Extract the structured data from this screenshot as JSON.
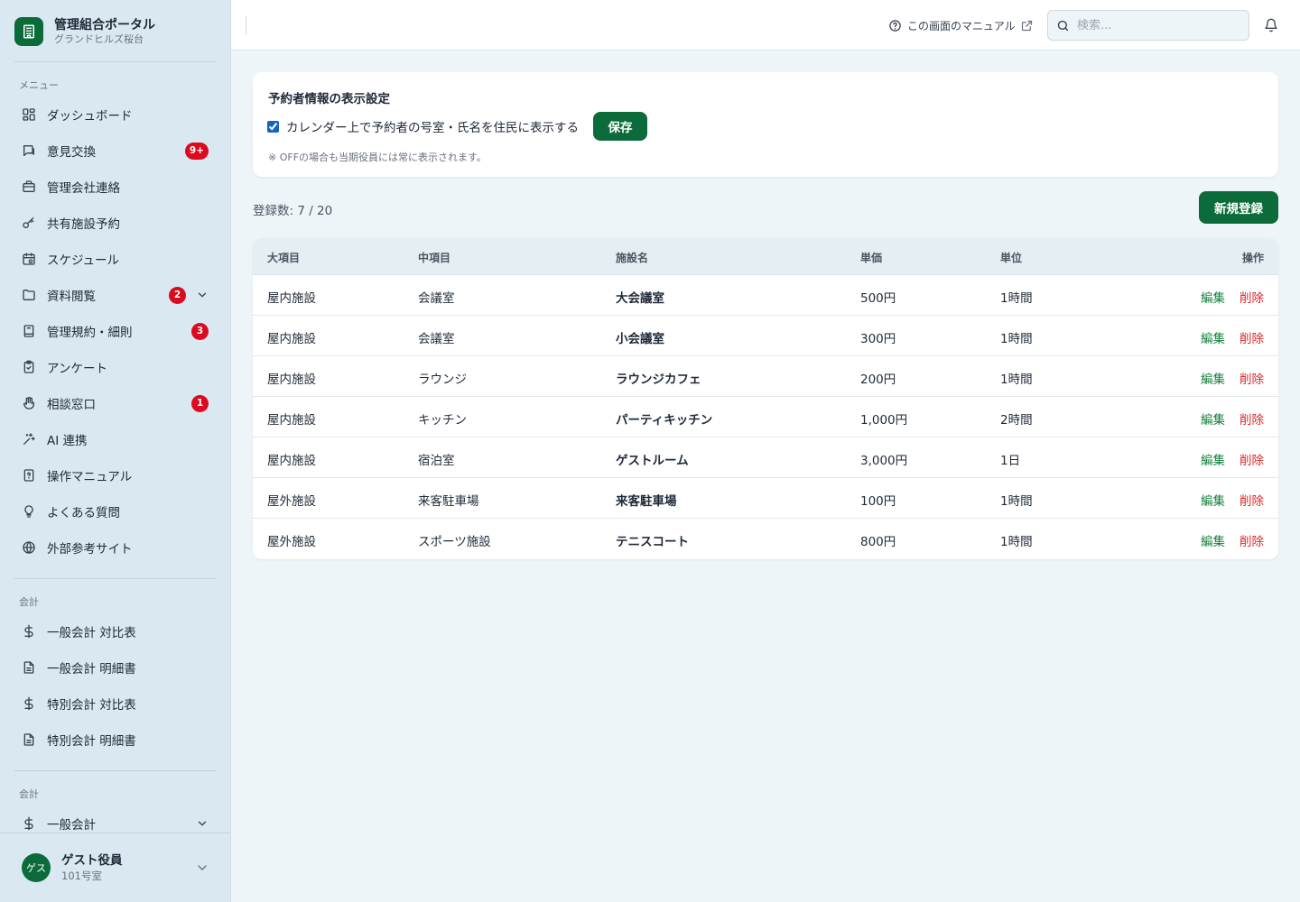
{
  "brand": {
    "title": "管理組合ポータル",
    "subtitle": "グランドヒルズ桜台"
  },
  "sidebar": {
    "menu_label": "メニュー",
    "items": [
      {
        "label": "ダッシュボード",
        "icon": "dashboard-icon"
      },
      {
        "label": "意見交換",
        "icon": "chat-icon",
        "badge": "9+"
      },
      {
        "label": "管理会社連絡",
        "icon": "briefcase-icon"
      },
      {
        "label": "共有施設予約",
        "icon": "key-icon"
      },
      {
        "label": "スケジュール",
        "icon": "calendar-icon"
      },
      {
        "label": "資料閲覧",
        "icon": "folder-icon",
        "badge": "2",
        "expandable": true
      },
      {
        "label": "管理規約・細則",
        "icon": "book-icon",
        "badge": "3"
      },
      {
        "label": "アンケート",
        "icon": "clipboard-icon"
      },
      {
        "label": "相談窓口",
        "icon": "hand-icon",
        "badge": "1"
      },
      {
        "label": "AI 連携",
        "icon": "sparkle-icon"
      },
      {
        "label": "操作マニュアル",
        "icon": "manual-icon"
      },
      {
        "label": "よくある質問",
        "icon": "lightbulb-icon"
      },
      {
        "label": "外部参考サイト",
        "icon": "globe-icon"
      }
    ],
    "accounting_label": "会計",
    "accounting_items": [
      {
        "label": "一般会計 対比表",
        "icon": "dollar-icon"
      },
      {
        "label": "一般会計 明細書",
        "icon": "document-icon"
      },
      {
        "label": "特別会計 対比表",
        "icon": "dollar-icon"
      },
      {
        "label": "特別会計 明細書",
        "icon": "document-icon"
      }
    ],
    "accounting2_label": "会計",
    "accounting2_items": [
      {
        "label": "一般会計",
        "icon": "dollar-icon",
        "expandable": true
      }
    ],
    "user": {
      "avatar": "ゲス",
      "name": "ゲスト役員",
      "room": "101号室"
    }
  },
  "header": {
    "manual_link": "この画面のマニュアル",
    "search_placeholder": "検索..."
  },
  "settings": {
    "title": "予約者情報の表示設定",
    "checkbox_label": "カレンダー上で予約者の号室・氏名を住民に表示する",
    "checked": true,
    "save_label": "保存",
    "note": "※ OFFの場合も当期役員には常に表示されます。"
  },
  "list": {
    "count_text": "登録数: 7 / 20",
    "new_button": "新規登録",
    "columns": [
      "大項目",
      "中項目",
      "施設名",
      "単価",
      "単位",
      "操作"
    ],
    "rows": [
      [
        "屋内施設",
        "会議室",
        "大会議室",
        "500円",
        "1時間"
      ],
      [
        "屋内施設",
        "会議室",
        "小会議室",
        "300円",
        "1時間"
      ],
      [
        "屋内施設",
        "ラウンジ",
        "ラウンジカフェ",
        "200円",
        "1時間"
      ],
      [
        "屋内施設",
        "キッチン",
        "パーティキッチン",
        "1,000円",
        "2時間"
      ],
      [
        "屋内施設",
        "宿泊室",
        "ゲストルーム",
        "3,000円",
        "1日"
      ],
      [
        "屋外施設",
        "来客駐車場",
        "来客駐車場",
        "100円",
        "1時間"
      ],
      [
        "屋外施設",
        "スポーツ施設",
        "テニスコート",
        "800円",
        "1時間"
      ]
    ],
    "edit_label": "編集",
    "delete_label": "削除"
  },
  "colors": {
    "accent": "#0b6b3a",
    "danger": "#dc2626",
    "badge": "#dc0a1e",
    "sidebar_bg": "#d9e8f1"
  }
}
